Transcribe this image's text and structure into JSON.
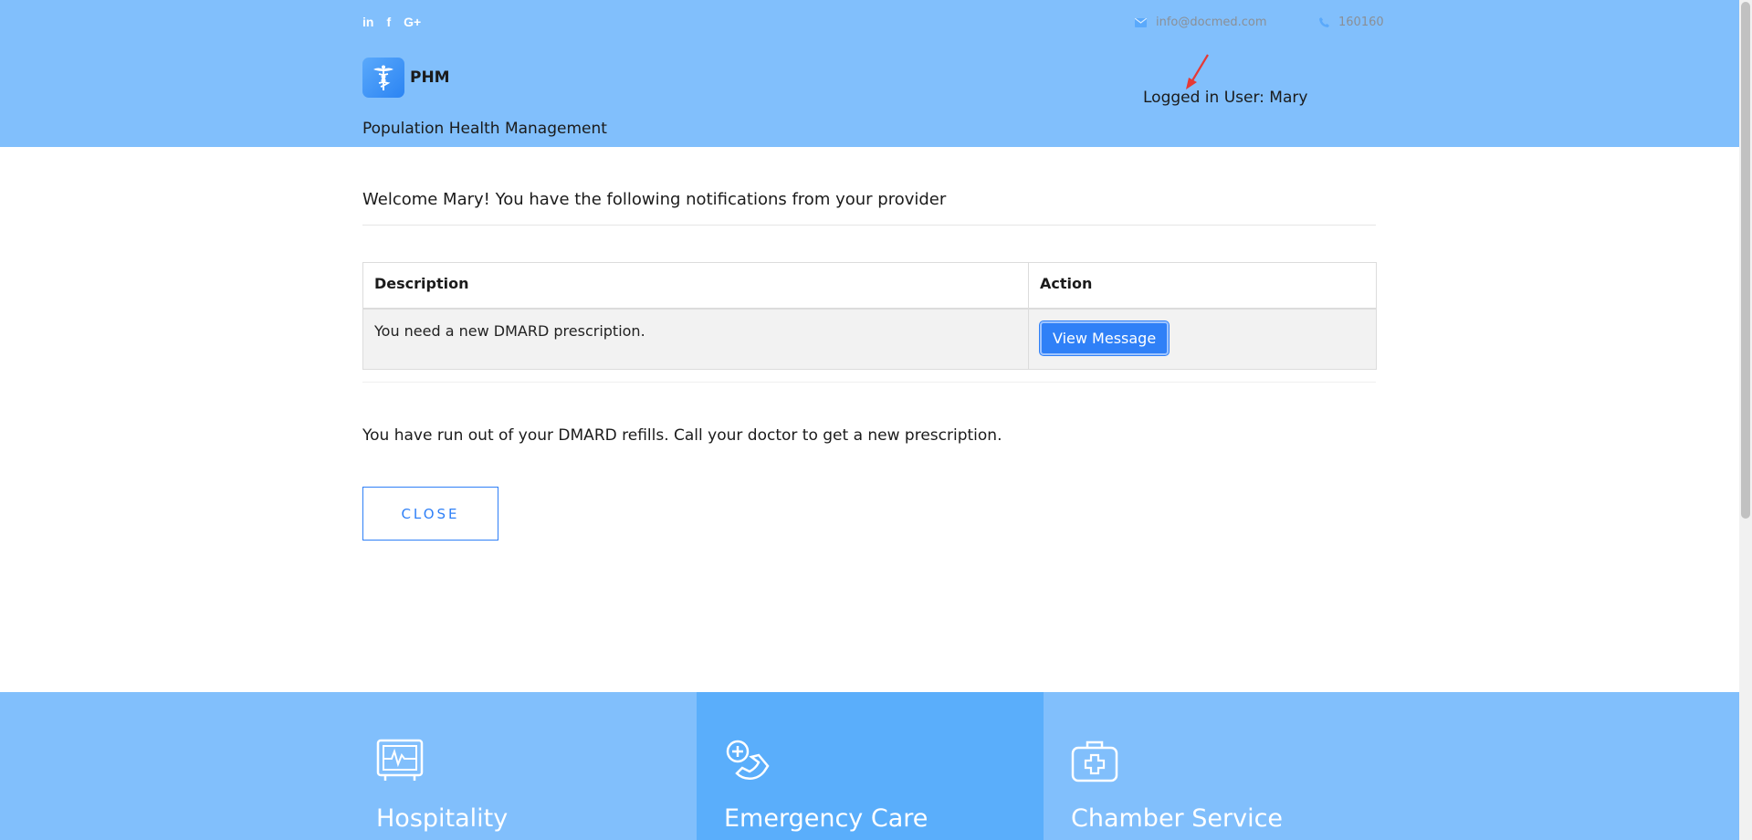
{
  "header": {
    "social": [
      "in",
      "f",
      "G+"
    ],
    "email": "info@docmed.com",
    "phone": "160160",
    "brand": "PHM",
    "tagline": "Population Health Management",
    "logged_in": "Logged in User: Mary"
  },
  "main": {
    "welcome": "Welcome Mary! You have the following notifications from your provider",
    "table": {
      "headers": [
        "Description",
        "Action"
      ],
      "rows": [
        {
          "description": "You need a new DMARD prescription.",
          "action": "View Message"
        }
      ]
    },
    "message": "You have run out of your DMARD refills. Call your doctor to get a new prescription.",
    "close_label": "CLOSE"
  },
  "services": [
    {
      "title": "Hospitality",
      "icon": "monitor-pulse-icon"
    },
    {
      "title": "Emergency Care",
      "icon": "phone-medical-icon"
    },
    {
      "title": "Chamber Service",
      "icon": "first-aid-kit-icon"
    }
  ],
  "colors": {
    "header_bg": "#81bffc",
    "accent": "#2f80f7",
    "service_highlight": "#5aaefb",
    "annotation_arrow": "#e53935"
  }
}
